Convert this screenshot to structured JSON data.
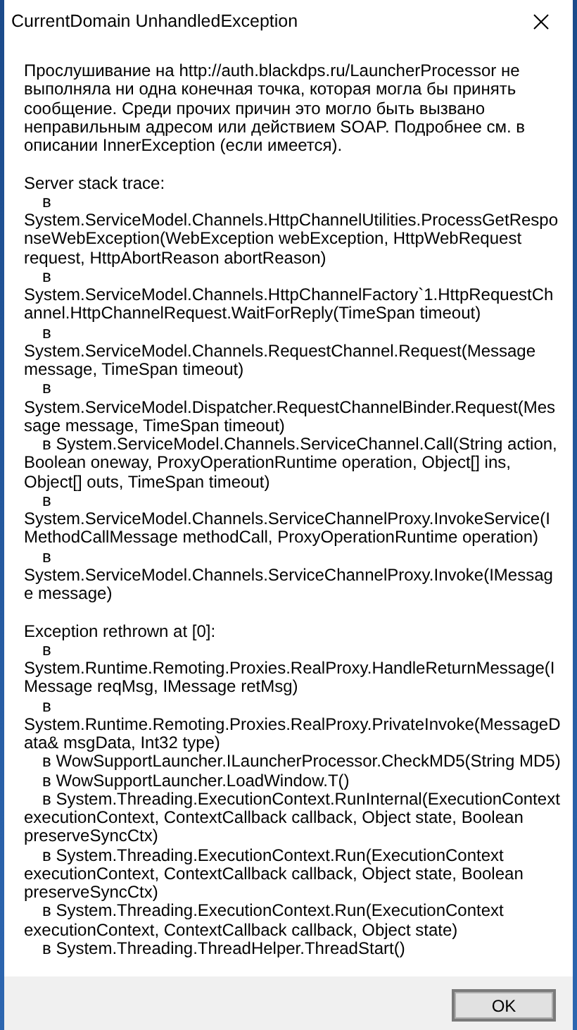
{
  "window": {
    "title": "CurrentDomain UnhandledException"
  },
  "message": "Прослушивание на http://auth.blackdps.ru/LauncherProcessor не выполняла ни одна конечная точка, которая могла бы принять сообщение. Среди прочих причин это могло быть вызвано неправильным адресом или действием SOAP. Подробнее см. в описании InnerException (если имеется).",
  "stack_sections": [
    {
      "heading": "Server stack trace:",
      "frames": [
        "в System.ServiceModel.Channels.HttpChannelUtilities.ProcessGetResponseWebException(WebException webException, HttpWebRequest request, HttpAbortReason abortReason)",
        "в System.ServiceModel.Channels.HttpChannelFactory`1.HttpRequestChannel.HttpChannelRequest.WaitForReply(TimeSpan timeout)",
        "в System.ServiceModel.Channels.RequestChannel.Request(Message message, TimeSpan timeout)",
        "в System.ServiceModel.Dispatcher.RequestChannelBinder.Request(Message message, TimeSpan timeout)",
        "в System.ServiceModel.Channels.ServiceChannel.Call(String action, Boolean oneway, ProxyOperationRuntime operation, Object[] ins, Object[] outs, TimeSpan timeout)",
        "в System.ServiceModel.Channels.ServiceChannelProxy.InvokeService(IMethodCallMessage methodCall, ProxyOperationRuntime operation)",
        "в System.ServiceModel.Channels.ServiceChannelProxy.Invoke(IMessage message)"
      ]
    },
    {
      "heading": "Exception rethrown at [0]:",
      "frames": [
        "в System.Runtime.Remoting.Proxies.RealProxy.HandleReturnMessage(IMessage reqMsg, IMessage retMsg)",
        "в System.Runtime.Remoting.Proxies.RealProxy.PrivateInvoke(MessageData& msgData, Int32 type)",
        "в WowSupportLauncher.ILauncherProcessor.CheckMD5(String MD5)",
        "в WowSupportLauncher.LoadWindow.T()",
        "в System.Threading.ExecutionContext.RunInternal(ExecutionContext executionContext, ContextCallback callback, Object state, Boolean preserveSyncCtx)",
        "в System.Threading.ExecutionContext.Run(ExecutionContext executionContext, ContextCallback callback, Object state, Boolean preserveSyncCtx)",
        "в System.Threading.ExecutionContext.Run(ExecutionContext executionContext, ContextCallback callback, Object state)",
        "в System.Threading.ThreadHelper.ThreadStart()"
      ]
    }
  ],
  "buttons": [
    "OK"
  ]
}
